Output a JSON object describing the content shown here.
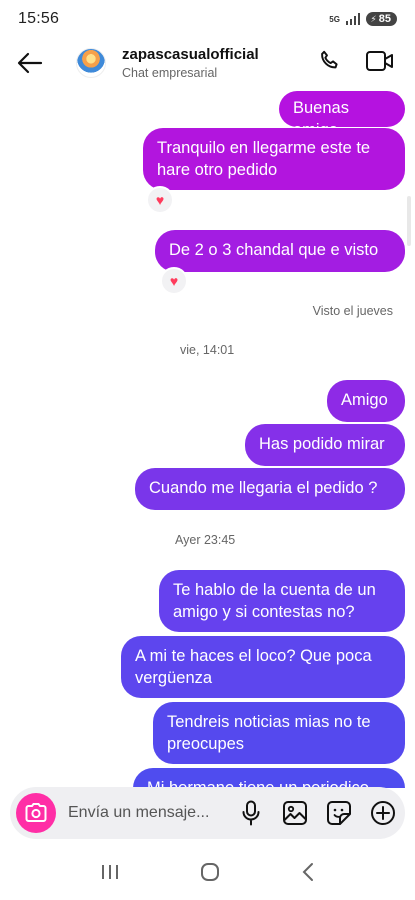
{
  "status": {
    "time": "15:56",
    "network": "5G",
    "battery": "85"
  },
  "header": {
    "title": "zapascasualofficial",
    "subtitle": "Chat empresarial"
  },
  "messages": [
    {
      "text": "Buenas amigo",
      "color": "#b512e0"
    },
    {
      "text": "Tranquilo en llegarme este te hare otro pedido",
      "color": "#b215de",
      "reaction": "heart"
    },
    {
      "text": "De 2 o 3 chandal que e visto",
      "color": "#a31de2",
      "reaction": "heart"
    },
    {
      "text": "Amigo",
      "color": "#8e2ae6"
    },
    {
      "text": "Has podido mirar",
      "color": "#8530e9"
    },
    {
      "text": "Cuando me llegaria el pedido ?",
      "color": "#7a36ea"
    },
    {
      "text": "Te hablo de la cuenta de un amigo y si contestas no?",
      "color": "#6641ee"
    },
    {
      "text": "A mi te haces el loco? Que poca vergüenza",
      "color": "#5d46ee"
    },
    {
      "text": "Tendreis noticias mias no te preocupes",
      "color": "#5549ee"
    },
    {
      "text": "Mi hermano tiene un periodico",
      "color": "#4f4cef"
    }
  ],
  "seen": "Visto el jueves",
  "dividers": {
    "first": "vie, 14:01",
    "second": "Ayer 23:45"
  },
  "composer": {
    "placeholder": "Envía un mensaje..."
  }
}
